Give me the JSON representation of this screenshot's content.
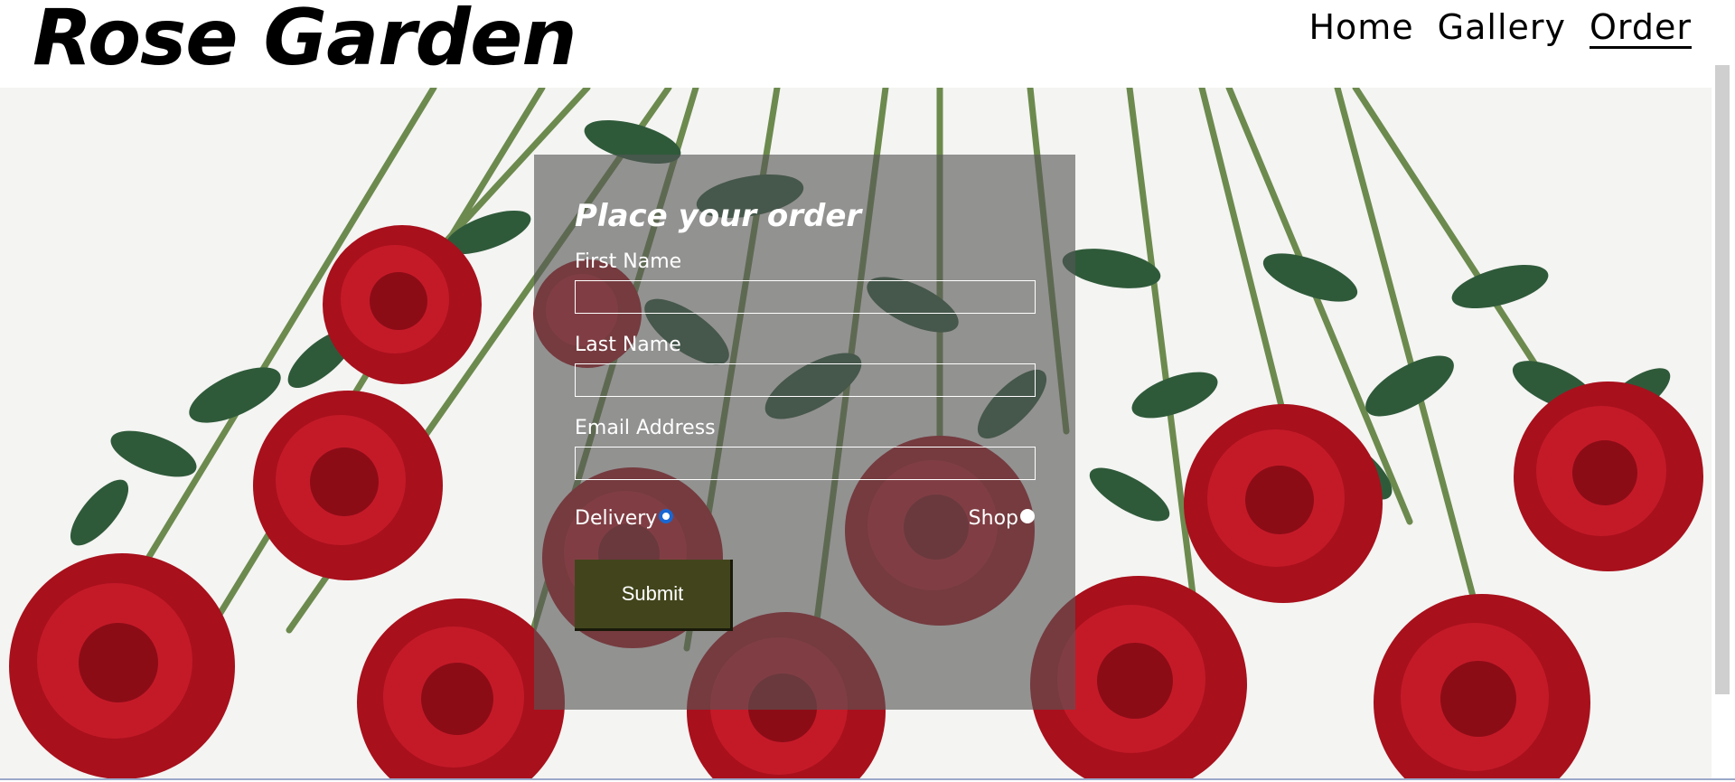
{
  "site": {
    "title": "Rose Garden"
  },
  "nav": {
    "items": [
      {
        "label": "Home",
        "active": false
      },
      {
        "label": "Gallery",
        "active": false
      },
      {
        "label": "Order",
        "active": true
      }
    ]
  },
  "order_form": {
    "title": "Place your order",
    "fields": [
      {
        "label": "First Name",
        "value": ""
      },
      {
        "label": "Last Name",
        "value": ""
      },
      {
        "label": "Email Address",
        "value": ""
      }
    ],
    "options": [
      {
        "label": "Delivery",
        "checked": true
      },
      {
        "label": "Shop",
        "checked": false
      }
    ],
    "submit_label": "Submit"
  },
  "colors": {
    "panel": "#555555",
    "submit": "#42451c",
    "rose": "#b3121f",
    "leaf": "#2f5a3a",
    "radio_accent": "#1967d2"
  },
  "icons": {
    "background": "red-roses-image"
  }
}
